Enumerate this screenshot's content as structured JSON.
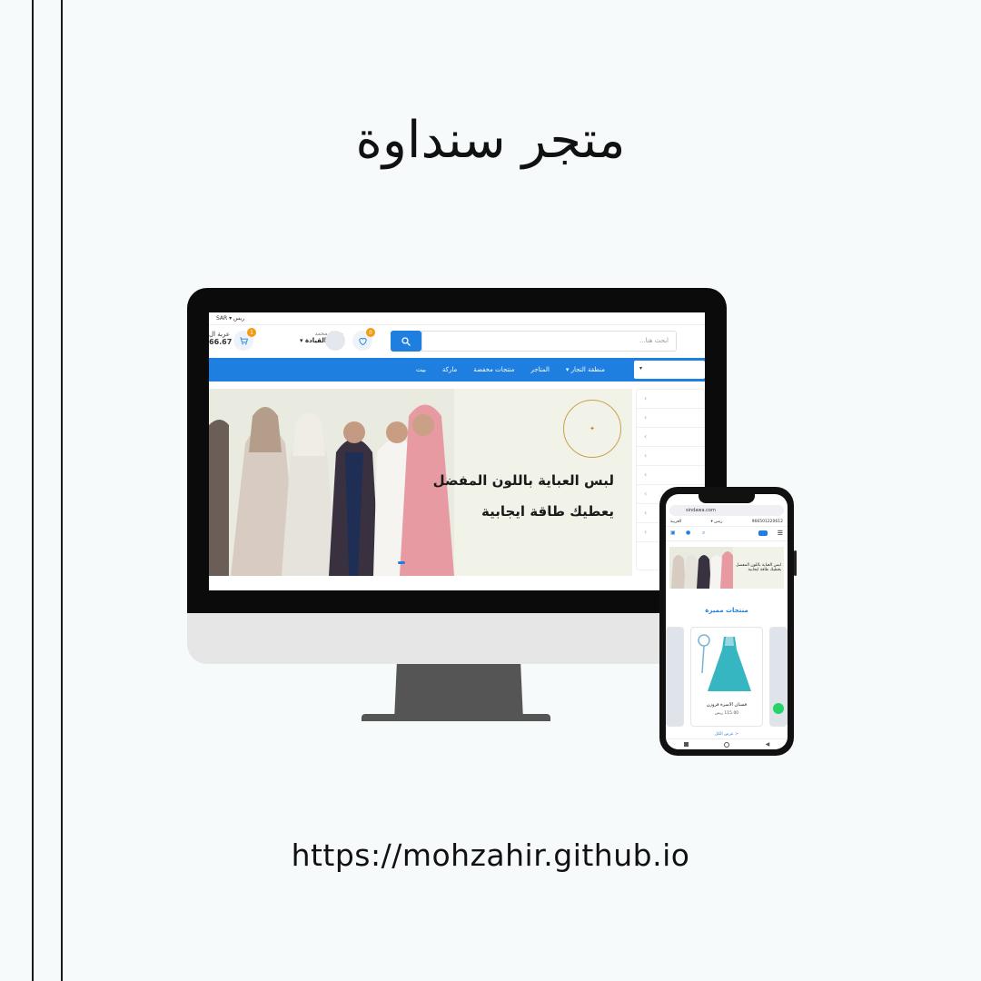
{
  "page": {
    "title": "متجر سنداوة",
    "url": "https://mohzahir.github.io"
  },
  "desktop": {
    "topbar": {
      "currency": "SAR ▾ ريس"
    },
    "header": {
      "cart_label": "عربة ال",
      "cart_amount": "66.67",
      "cart_count": "1",
      "wishlist_count": "0",
      "user_greeting": "مرحبًا, محمد",
      "user_dashboard": "لوحة القيادة ▾",
      "search_placeholder": "ابحث هنا..."
    },
    "nav": {
      "items": [
        "بيت",
        "ماركة",
        "منتجات مخفضة",
        "المتاجر",
        "منطقة التجار ▾"
      ]
    },
    "banner": {
      "line1": "لبس العباية باللون المفضل",
      "line2": "يعطيك طاقة ايجابية"
    }
  },
  "mobile": {
    "url": "sindawa.com",
    "currency": "ريس ▾",
    "language": "العربية",
    "phone": "966501220612",
    "banner_text": "لبس العباية باللون المفضل يعطيك طاقة ايجابية",
    "featured_title": "منتجات مميزة",
    "product_name": "فستان الاميرة فروزن",
    "product_price": "115.00 ريس",
    "view_all": "< عرض الكل"
  },
  "colors": {
    "brand_blue": "#1e7fe0",
    "badge_orange": "#f39c12",
    "whatsapp": "#25d366"
  }
}
